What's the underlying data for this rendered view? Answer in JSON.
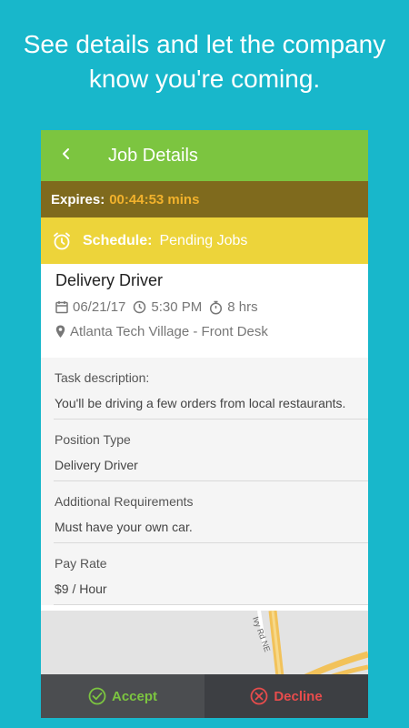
{
  "headline": {
    "line1": "See details and let the company",
    "line2": "know you're coming."
  },
  "appbar": {
    "title": "Job Details",
    "back_icon": "chevron-left-icon"
  },
  "expires": {
    "label": "Expires:",
    "value": "00:44:53 mins"
  },
  "schedule": {
    "label": "Schedule:",
    "value": "Pending Jobs",
    "icon": "alarm-clock-icon"
  },
  "job": {
    "title": "Delivery Driver",
    "date": "06/21/17",
    "time": "5:30 PM",
    "duration": "8 hrs",
    "location": "Atlanta Tech Village - Front Desk"
  },
  "fields": [
    {
      "key": "Task description:",
      "value": "You'll be driving a few orders from local restaurants."
    },
    {
      "key": "Position Type",
      "value": "Delivery Driver"
    },
    {
      "key": "Additional Requirements",
      "value": "Must have your own car."
    },
    {
      "key": "Pay Rate",
      "value": "$9 / Hour"
    }
  ],
  "map": {
    "road_label": "Ivy Rd NE"
  },
  "actions": {
    "accept": "Accept",
    "decline": "Decline"
  },
  "colors": {
    "background": "#18b7cb",
    "appbar": "#7cc540",
    "expires_bg": "#7f6a1d",
    "expires_value": "#f2b22c",
    "schedule_bg": "#edd43a",
    "accept": "#7cc540",
    "decline": "#e84c4c"
  }
}
